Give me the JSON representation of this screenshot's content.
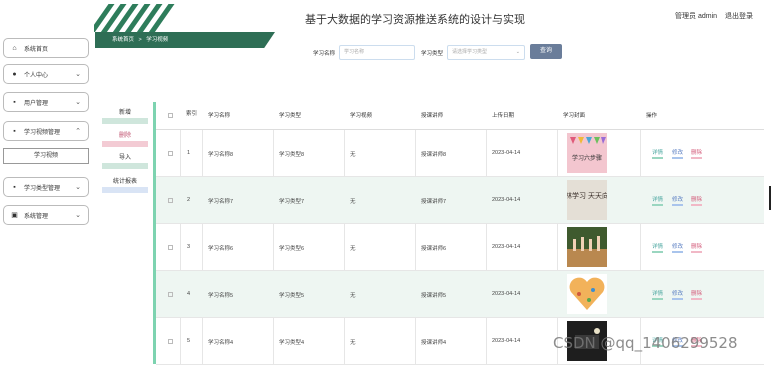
{
  "app": {
    "title": "基于大数据的学习资源推送系统的设计与实现",
    "user_label": "管理员 admin",
    "logout": "退出登录"
  },
  "breadcrumb": {
    "home": "系统首页",
    "sep": ">",
    "current": "学习视频"
  },
  "sidebar": {
    "items": [
      {
        "label": "系统首页",
        "icon": "home-icon"
      },
      {
        "label": "个人中心",
        "icon": "person-icon"
      },
      {
        "label": "用户管理",
        "icon": "grid-icon"
      },
      {
        "label": "学习视频管理",
        "icon": "grid-icon"
      },
      {
        "label": "学习类型管理",
        "icon": "grid-icon"
      },
      {
        "label": "系统管理",
        "icon": "calendar-icon"
      }
    ],
    "sub_item": "学习视频"
  },
  "search": {
    "name_label": "学习名称",
    "name_placeholder": "学习名称",
    "type_label": "学习类型",
    "type_placeholder": "请选择学习类型",
    "button": "查询"
  },
  "actions": {
    "add": "新增",
    "delete": "删除",
    "import": "导入",
    "stats": "统计报表"
  },
  "table": {
    "headers": [
      "索引",
      "学习名称",
      "学习类型",
      "学习视频",
      "授课讲师",
      "上传日期",
      "学习封面",
      "操作"
    ],
    "rows": [
      {
        "index": "1",
        "name": "学习名称8",
        "type": "学习类型8",
        "video": "无",
        "teacher": "授课讲师8",
        "date": "2023-04-14"
      },
      {
        "index": "2",
        "name": "学习名称7",
        "type": "学习类型7",
        "video": "无",
        "teacher": "授课讲师7",
        "date": "2023-04-14"
      },
      {
        "index": "3",
        "name": "学习名称6",
        "type": "学习类型6",
        "video": "无",
        "teacher": "授课讲师6",
        "date": "2023-04-14"
      },
      {
        "index": "4",
        "name": "学习名称5",
        "type": "学习类型5",
        "video": "无",
        "teacher": "授课讲师5",
        "date": "2023-04-14"
      },
      {
        "index": "5",
        "name": "学习名称4",
        "type": "学习类型4",
        "video": "无",
        "teacher": "授课讲师4",
        "date": "2023-04-14"
      }
    ],
    "row_actions": {
      "detail": "详情",
      "edit": "修改",
      "delete": "删除"
    },
    "thumb_texts": [
      "学习六步骤",
      "森林学习 天天向上"
    ]
  },
  "watermark": "CSDN @qq_1406299528",
  "colors": {
    "accent": "#2e6e55",
    "table_border": "#7dd3b0",
    "search_button": "#6a7d9a"
  }
}
